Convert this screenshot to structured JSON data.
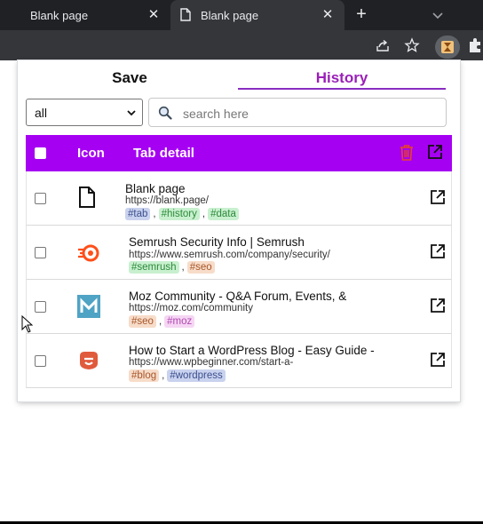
{
  "browser": {
    "tabs": [
      {
        "title": "Blank page",
        "active": false
      },
      {
        "title": "Blank page",
        "active": true
      }
    ],
    "close_glyph": "✕",
    "new_tab_glyph": "+"
  },
  "popup": {
    "nav": {
      "save_label": "Save",
      "history_label": "History",
      "active": "history"
    },
    "filter": {
      "selected": "all"
    },
    "search": {
      "placeholder": "search here",
      "value": ""
    },
    "table": {
      "header": {
        "icon_label": "Icon",
        "detail_label": "Tab detail"
      },
      "rows": [
        {
          "title": "Blank page",
          "url": "https://blank.page/",
          "favicon": "page-icon",
          "tags": [
            {
              "text": "#tab",
              "bg": "#c9d2ee",
              "color": "#3d4f8f"
            },
            {
              "text": "#history",
              "bg": "#c8f0cf",
              "color": "#2e8a3b"
            },
            {
              "text": "#data",
              "bg": "#c8f0cf",
              "color": "#2e8a3b"
            }
          ]
        },
        {
          "title": "Semrush Security Info | Semrush",
          "url": "https://www.semrush.com/company/security/",
          "favicon": "semrush-icon",
          "tags": [
            {
              "text": "#semrush",
              "bg": "#c8f0cf",
              "color": "#2e8a3b"
            },
            {
              "text": "#seo",
              "bg": "#f7dcc9",
              "color": "#a8572a"
            }
          ]
        },
        {
          "title": "Moz Community - Q&A Forum, Events, &",
          "url": "https://moz.com/community",
          "favicon": "moz-icon",
          "tags": [
            {
              "text": "#seo",
              "bg": "#f7dcc9",
              "color": "#a8572a"
            },
            {
              "text": "#moz",
              "bg": "#f6d6f4",
              "color": "#b04bb0"
            }
          ]
        },
        {
          "title": "How to Start a WordPress Blog - Easy Guide -",
          "url": "https://www.wpbeginner.com/start-a-",
          "favicon": "wpbeginner-icon",
          "tags": [
            {
              "text": "#blog",
              "bg": "#f7dcc9",
              "color": "#a8572a"
            },
            {
              "text": "#wordpress",
              "bg": "#c9d2ee",
              "color": "#3d4f8f"
            }
          ]
        }
      ]
    }
  },
  "colors": {
    "accent": "#a600f3",
    "history_text": "#9a1fb8",
    "chrome_dark": "#202124",
    "chrome_toolbar": "#35363a",
    "trash": "#e8422c"
  }
}
